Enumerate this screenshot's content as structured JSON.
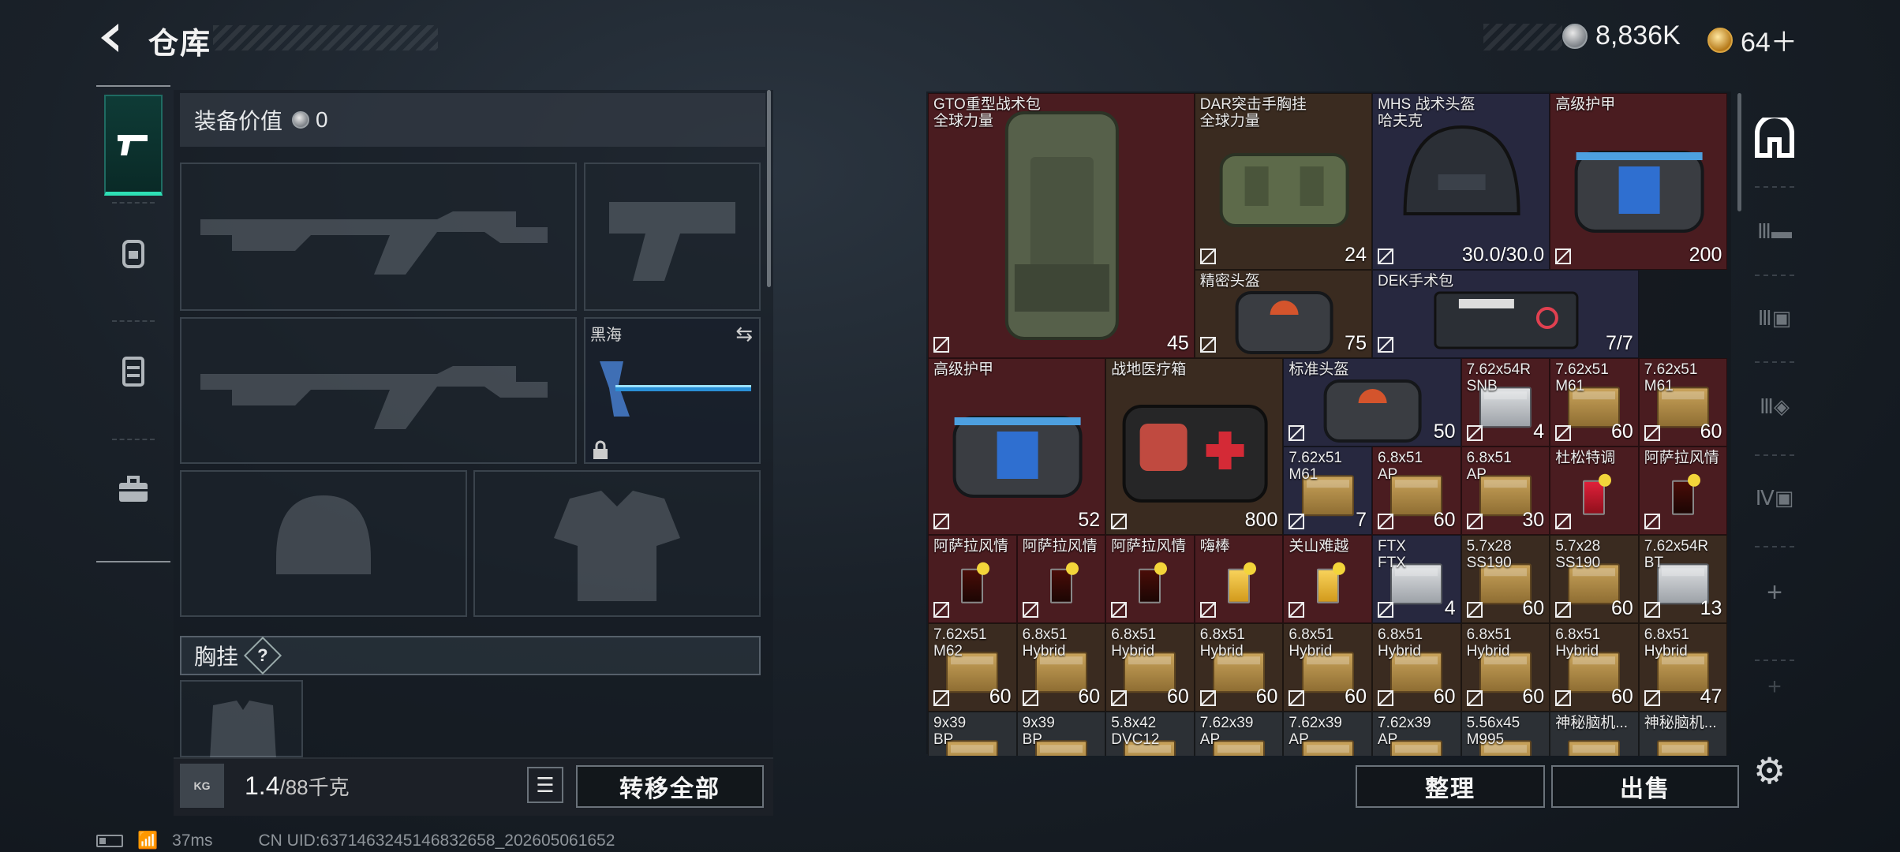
{
  "header": {
    "title": "仓库"
  },
  "currency": {
    "silver": "8,836K",
    "gold": "64＋"
  },
  "loadout": {
    "value_label": "装备价值",
    "value": "0",
    "melee_name": "黑海",
    "chest_label": "胸挂",
    "chest_help": "?",
    "weight_value": "1.4",
    "weight_max": "/88千克",
    "kg_label": "KG",
    "transfer_all": "转移全部"
  },
  "stash": {
    "items": [
      {
        "name": "GTO重型战术包\n全球力量",
        "count": "45",
        "bg": "red",
        "kind": "backpack-tall",
        "icon": "backpack-icon"
      },
      {
        "name": "DAR突击手胸挂\n全球力量",
        "count": "24",
        "bg": "brown",
        "kind": "vest",
        "icon": "vest-icon"
      },
      {
        "name": "MHS 战术头盔\n哈夫克",
        "count": "30.0/30.0",
        "bg": "blue",
        "kind": "helmet",
        "icon": "helmet-icon"
      },
      {
        "name": "高级护甲",
        "count": "200",
        "bg": "red",
        "kind": "armor",
        "icon": "armor-icon"
      },
      {
        "name": "精密头盔",
        "count": "75",
        "bg": "brown",
        "kind": "bag",
        "icon": "helmet-icon"
      },
      {
        "name": "DEK手术包",
        "count": "7/7",
        "bg": "blue",
        "kind": "kit",
        "icon": "surgical-kit-icon"
      },
      {
        "name": "高级护甲",
        "count": "52",
        "bg": "red",
        "kind": "armor",
        "icon": "armor-icon"
      },
      {
        "name": "战地医疗箱",
        "count": "800",
        "bg": "brown",
        "kind": "medbox",
        "icon": "medbox-icon"
      },
      {
        "name": "标准头盔",
        "count": "50",
        "bg": "blue",
        "kind": "bag",
        "icon": "helmet-icon"
      },
      {
        "name": "7.62x54R\nSNB",
        "count": "4",
        "bg": "red",
        "kind": "ammo-w",
        "icon": "ammo-icon"
      },
      {
        "name": "7.62x51\nM61",
        "count": "60",
        "bg": "red",
        "kind": "ammo",
        "icon": "ammo-icon"
      },
      {
        "name": "7.62x51\nM61",
        "count": "60",
        "bg": "red",
        "kind": "ammo",
        "icon": "ammo-icon"
      },
      {
        "name": "7.62x51\nM61",
        "count": "7",
        "bg": "blue",
        "kind": "ammo",
        "icon": "ammo-icon"
      },
      {
        "name": "6.8x51\nAP",
        "count": "60",
        "bg": "red",
        "kind": "ammo",
        "icon": "ammo-icon"
      },
      {
        "name": "6.8x51\nAP",
        "count": "30",
        "bg": "red",
        "kind": "ammo",
        "icon": "ammo-icon"
      },
      {
        "name": "杜松特调",
        "count": "",
        "bg": "red",
        "kind": "drink-r",
        "icon": "drink-icon"
      },
      {
        "name": "阿萨拉风情",
        "count": "",
        "bg": "red",
        "kind": "drink",
        "icon": "drink-icon"
      },
      {
        "name": "阿萨拉风情",
        "count": "",
        "bg": "red",
        "kind": "drink",
        "icon": "drink-icon"
      },
      {
        "name": "阿萨拉风情",
        "count": "",
        "bg": "red",
        "kind": "drink",
        "icon": "drink-icon"
      },
      {
        "name": "阿萨拉风情",
        "count": "",
        "bg": "red",
        "kind": "drink",
        "icon": "drink-icon"
      },
      {
        "name": "嗨棒",
        "count": "",
        "bg": "red",
        "kind": "drink-y",
        "icon": "drink-icon"
      },
      {
        "name": "关山难越",
        "count": "",
        "bg": "red",
        "kind": "drink-y",
        "icon": "drink-icon"
      },
      {
        "name": "FTX\nFTX",
        "count": "4",
        "bg": "blue",
        "kind": "ammo-w",
        "icon": "ammo-icon"
      },
      {
        "name": "5.7x28\nSS190",
        "count": "60",
        "bg": "brown",
        "kind": "ammo",
        "icon": "ammo-icon"
      },
      {
        "name": "5.7x28\nSS190",
        "count": "60",
        "bg": "brown",
        "kind": "ammo",
        "icon": "ammo-icon"
      },
      {
        "name": "7.62x54R\nBT",
        "count": "13",
        "bg": "brown",
        "kind": "ammo-w",
        "icon": "ammo-icon"
      },
      {
        "name": "7.62x51\nM62",
        "count": "60",
        "bg": "brown",
        "kind": "ammo",
        "icon": "ammo-icon"
      },
      {
        "name": "6.8x51\nHybrid",
        "count": "60",
        "bg": "brown",
        "kind": "ammo",
        "icon": "ammo-icon"
      },
      {
        "name": "6.8x51\nHybrid",
        "count": "60",
        "bg": "brown",
        "kind": "ammo",
        "icon": "ammo-icon"
      },
      {
        "name": "6.8x51\nHybrid",
        "count": "60",
        "bg": "brown",
        "kind": "ammo",
        "icon": "ammo-icon"
      },
      {
        "name": "6.8x51\nHybrid",
        "count": "60",
        "bg": "brown",
        "kind": "ammo",
        "icon": "ammo-icon"
      },
      {
        "name": "6.8x51\nHybrid",
        "count": "60",
        "bg": "brown",
        "kind": "ammo",
        "icon": "ammo-icon"
      },
      {
        "name": "6.8x51\nHybrid",
        "count": "60",
        "bg": "brown",
        "kind": "ammo",
        "icon": "ammo-icon"
      },
      {
        "name": "6.8x51\nHybrid",
        "count": "60",
        "bg": "brown",
        "kind": "ammo",
        "icon": "ammo-icon"
      },
      {
        "name": "6.8x51\nHybrid",
        "count": "47",
        "bg": "brown",
        "kind": "ammo",
        "icon": "ammo-icon"
      },
      {
        "name": "9x39\nBP",
        "count": "",
        "bg": "gray",
        "kind": "ammo",
        "icon": "ammo-icon"
      },
      {
        "name": "9x39\nBP",
        "count": "",
        "bg": "gray",
        "kind": "ammo",
        "icon": "ammo-icon"
      },
      {
        "name": "5.8x42\nDVC12",
        "count": "",
        "bg": "gray",
        "kind": "ammo",
        "icon": "ammo-icon"
      },
      {
        "name": "7.62x39\nAP",
        "count": "",
        "bg": "gray",
        "kind": "ammo",
        "icon": "ammo-icon"
      },
      {
        "name": "7.62x39\nAP",
        "count": "",
        "bg": "gray",
        "kind": "ammo",
        "icon": "ammo-icon"
      },
      {
        "name": "7.62x39\nAP",
        "count": "",
        "bg": "gray",
        "kind": "ammo",
        "icon": "ammo-icon"
      },
      {
        "name": "5.56x45\nM995",
        "count": "",
        "bg": "gray",
        "kind": "ammo",
        "icon": "ammo-icon"
      },
      {
        "name": "神秘脑机...",
        "count": "",
        "bg": "gray",
        "kind": "ammo",
        "icon": "chip-icon"
      },
      {
        "name": "神秘脑机...",
        "count": "",
        "bg": "gray",
        "kind": "ammo",
        "icon": "chip-icon"
      }
    ],
    "sort_label": "整理",
    "sell_label": "出售"
  },
  "status": {
    "ping": "37ms",
    "uid": "CN UID:6371463245146832658_202605061652"
  }
}
